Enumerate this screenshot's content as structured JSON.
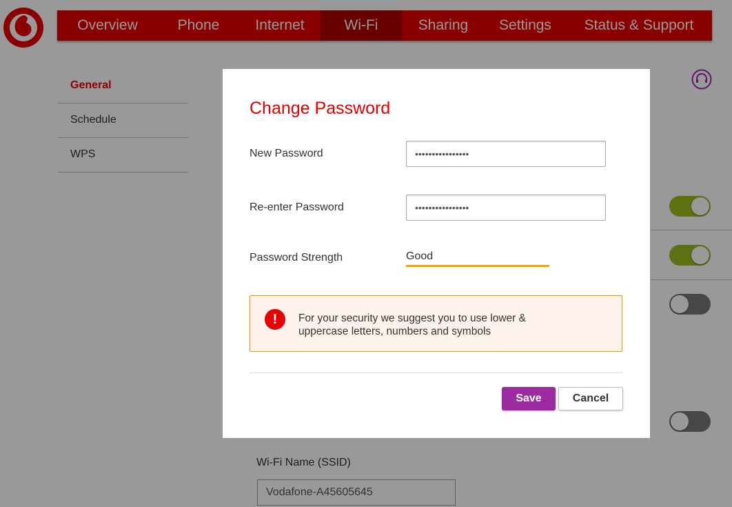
{
  "nav": {
    "items": [
      {
        "label": "Overview"
      },
      {
        "label": "Phone"
      },
      {
        "label": "Internet"
      },
      {
        "label": "Wi-Fi"
      },
      {
        "label": "Sharing"
      },
      {
        "label": "Settings"
      },
      {
        "label": "Status & Support"
      }
    ],
    "active": "Wi-Fi"
  },
  "sidebar": {
    "items": [
      {
        "label": "General"
      },
      {
        "label": "Schedule"
      },
      {
        "label": "WPS"
      }
    ],
    "active": "General"
  },
  "toggles": [
    {
      "state": "on"
    },
    {
      "state": "on"
    },
    {
      "state": "off"
    },
    {
      "state": "off"
    }
  ],
  "ssid": {
    "label": "Wi-Fi Name (SSID)",
    "value": "Vodafone-A45605645"
  },
  "modal": {
    "title": "Change Password",
    "new_password_label": "New Password",
    "new_password_value": "••••••••••••••••",
    "reenter_label": "Re-enter Password",
    "reenter_value": "••••••••••••••••",
    "strength_label": "Password Strength",
    "strength_value": "Good",
    "alert_icon": "!",
    "alert_text": "For your security we suggest you to use lower & uppercase letters, numbers and symbols",
    "save_label": "Save",
    "cancel_label": "Cancel"
  },
  "colors": {
    "brand_red": "#e60000",
    "save_purple": "#9c2aa0",
    "strength_bar": "#f0a500",
    "toggle_on": "#9bbb1e"
  }
}
